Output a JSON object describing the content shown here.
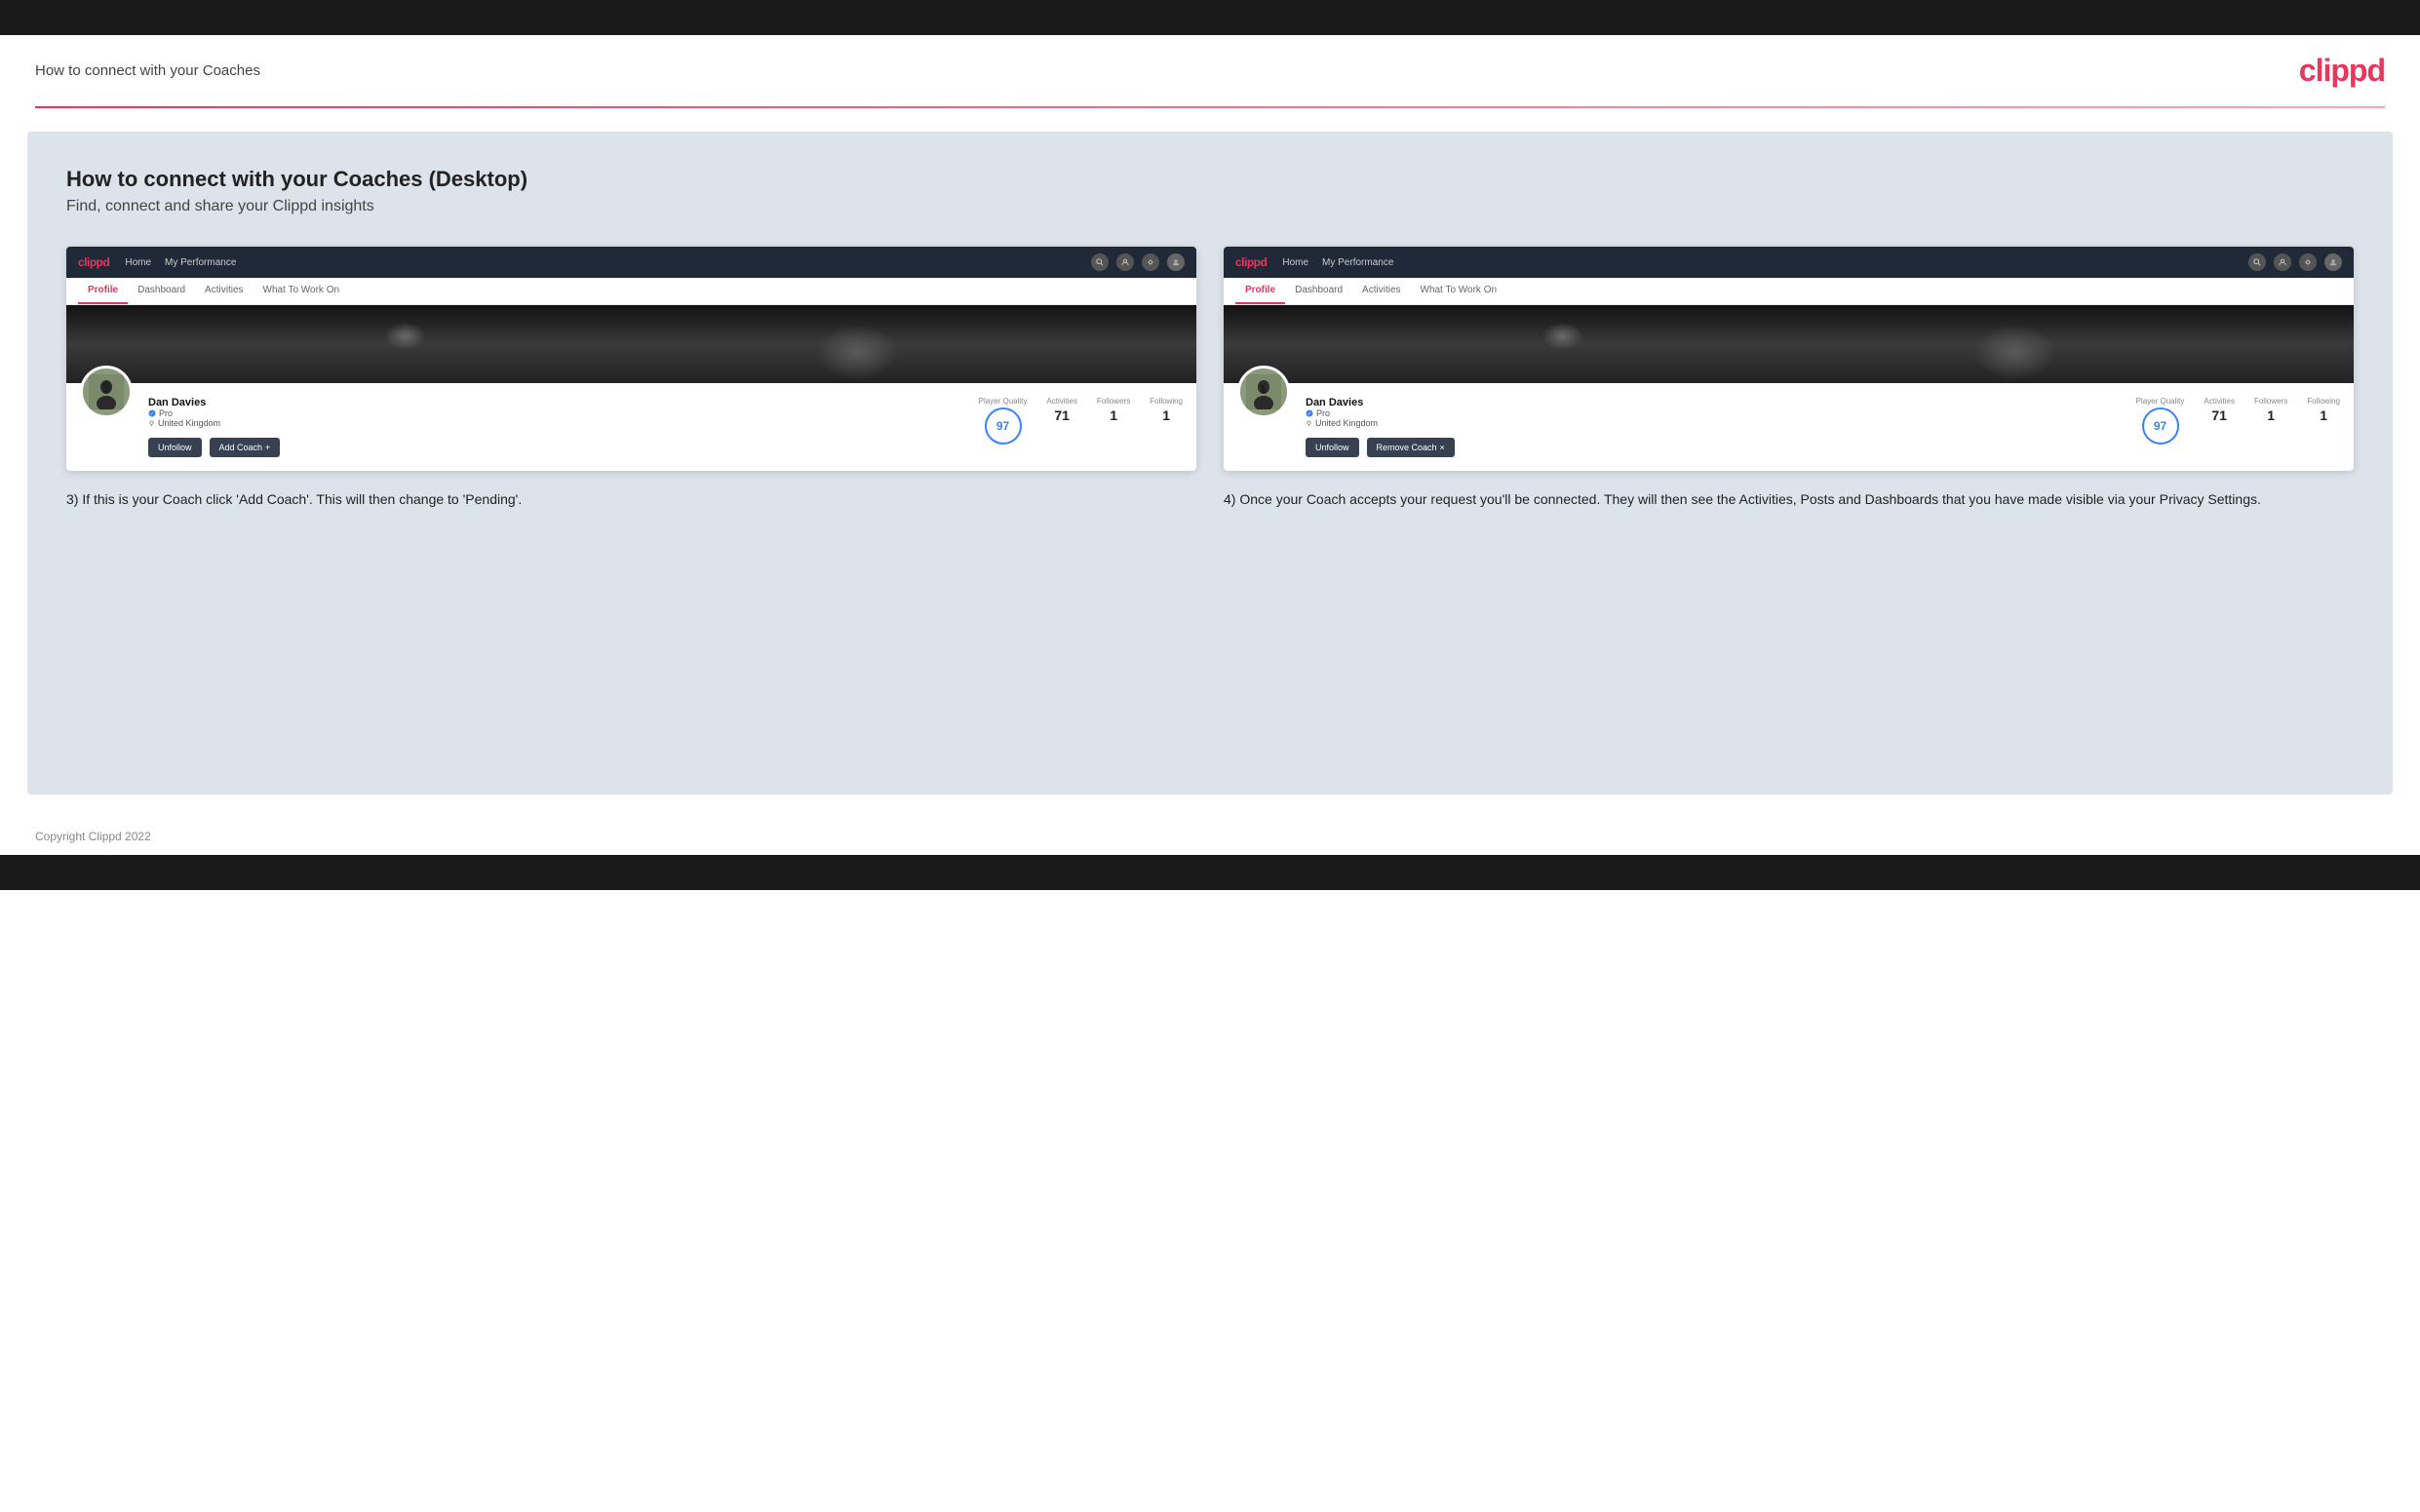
{
  "top_bar": {},
  "header": {
    "title": "How to connect with your Coaches",
    "logo": "clippd"
  },
  "main": {
    "section_title": "How to connect with your Coaches (Desktop)",
    "section_subtitle": "Find, connect and share your Clippd insights",
    "left_panel": {
      "mock_browser": {
        "nav": {
          "logo": "clippd",
          "links": [
            "Home",
            "My Performance"
          ],
          "icons": [
            "search",
            "user",
            "settings",
            "avatar"
          ]
        },
        "tabs": [
          "Profile",
          "Dashboard",
          "Activities",
          "What To Work On"
        ],
        "active_tab": "Profile",
        "profile": {
          "user_name": "Dan Davies",
          "role": "Pro",
          "location": "United Kingdom",
          "player_quality_label": "Player Quality",
          "player_quality_value": "97",
          "activities_label": "Activities",
          "activities_value": "71",
          "followers_label": "Followers",
          "followers_value": "1",
          "following_label": "Following",
          "following_value": "1"
        },
        "buttons": {
          "unfollow": "Unfollow",
          "add_coach": "Add Coach"
        }
      },
      "description": "3) If this is your Coach click 'Add Coach'. This will then change to 'Pending'."
    },
    "right_panel": {
      "mock_browser": {
        "nav": {
          "logo": "clippd",
          "links": [
            "Home",
            "My Performance"
          ],
          "icons": [
            "search",
            "user",
            "settings",
            "avatar"
          ]
        },
        "tabs": [
          "Profile",
          "Dashboard",
          "Activities",
          "What To Work On"
        ],
        "active_tab": "Profile",
        "profile": {
          "user_name": "Dan Davies",
          "role": "Pro",
          "location": "United Kingdom",
          "player_quality_label": "Player Quality",
          "player_quality_value": "97",
          "activities_label": "Activities",
          "activities_value": "71",
          "followers_label": "Followers",
          "followers_value": "1",
          "following_label": "Following",
          "following_value": "1"
        },
        "buttons": {
          "unfollow": "Unfollow",
          "remove_coach": "Remove Coach"
        }
      },
      "description": "4) Once your Coach accepts your request you'll be connected. They will then see the Activities, Posts and Dashboards that you have made visible via your Privacy Settings."
    }
  },
  "footer": {
    "copyright": "Copyright Clippd 2022"
  }
}
